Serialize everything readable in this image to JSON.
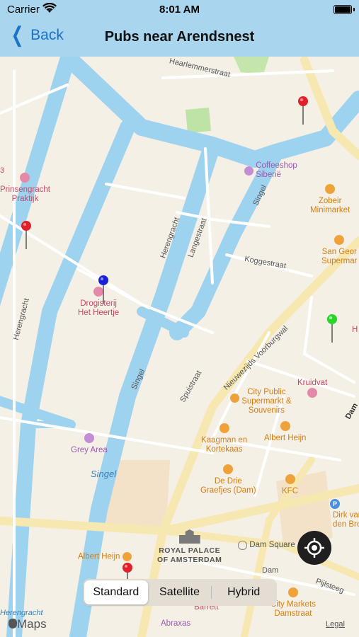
{
  "status": {
    "carrier": "Carrier",
    "time": "8:01 AM",
    "icons": [
      "wifi-icon",
      "battery-icon"
    ]
  },
  "nav": {
    "back_label": "Back",
    "title": "Pubs near Arendsnest"
  },
  "map": {
    "streets": [
      "Haarlemmerstraat",
      "Herengracht",
      "Langestraat",
      "Singel",
      "Koggestraat",
      "Spuistraat",
      "Nieuwezijds Voorburgwal",
      "Singel",
      "Herengracht",
      "Dam",
      "Pijlsteeg",
      "Dam",
      "Herengracht"
    ],
    "pois": [
      {
        "name": "Prinsengracht\nPraktijk",
        "color": "pink",
        "icon": "pharmacy-icon"
      },
      {
        "name": "Coffeeshop\nSiberië",
        "color": "purple",
        "icon": "coffee-icon"
      },
      {
        "name": "Zobeir\nMinimarket",
        "color": "orange",
        "icon": "shop-icon"
      },
      {
        "name": "San Geor\nSupermar",
        "color": "orange",
        "icon": "shop-icon"
      },
      {
        "name": "Drogisterij\nHet Heertje",
        "color": "pink",
        "icon": "pharmacy-icon"
      },
      {
        "name": "City Public\nSupermarkt &\nSouvenirs",
        "color": "orange",
        "icon": "cart-icon"
      },
      {
        "name": "Kruidvat",
        "color": "pink",
        "icon": "pharmacy-icon"
      },
      {
        "name": "Kaagman en\nKortekaas",
        "color": "orange",
        "icon": "restaurant-icon"
      },
      {
        "name": "Albert Heijn",
        "color": "orange",
        "icon": "cart-icon"
      },
      {
        "name": "Grey Area",
        "color": "purple",
        "icon": "coffee-icon"
      },
      {
        "name": "De Drie\nGraefjes (Dam)",
        "color": "orange",
        "icon": "restaurant-icon"
      },
      {
        "name": "KFC",
        "color": "orange",
        "icon": "restaurant-icon"
      },
      {
        "name": "Dirk van\nden Broe",
        "color": "orange",
        "icon": "cart-icon"
      },
      {
        "name": "ROYAL PALACE\nOF AMSTERDAM",
        "color": "gray",
        "icon": "palace-icon"
      },
      {
        "name": "Dam Square",
        "color": "gray",
        "icon": "landmark-icon"
      },
      {
        "name": "Albert Heijn",
        "color": "orange",
        "icon": "cart-icon"
      },
      {
        "name": "Barrett",
        "color": "pink",
        "icon": "shop-icon"
      },
      {
        "name": "City Markets\nDamstraat",
        "color": "orange",
        "icon": "cart-icon"
      },
      {
        "name": "Abraxas",
        "color": "purple",
        "icon": "coffee-icon"
      },
      {
        "name": "H",
        "color": "pink",
        "icon": ""
      }
    ],
    "pins": [
      {
        "color": "#e0202a",
        "label": "red"
      },
      {
        "color": "#e0202a",
        "label": "red"
      },
      {
        "color": "#1a22d8",
        "label": "blue"
      },
      {
        "color": "#2ad52a",
        "label": "green"
      },
      {
        "color": "#e0202a",
        "label": "red"
      }
    ],
    "numeral": "3"
  },
  "map_type": {
    "options": [
      "Standard",
      "Satellite",
      "Hybrid"
    ],
    "selected": "Standard"
  },
  "attribution": {
    "logo": "Maps",
    "legal": "Legal"
  }
}
